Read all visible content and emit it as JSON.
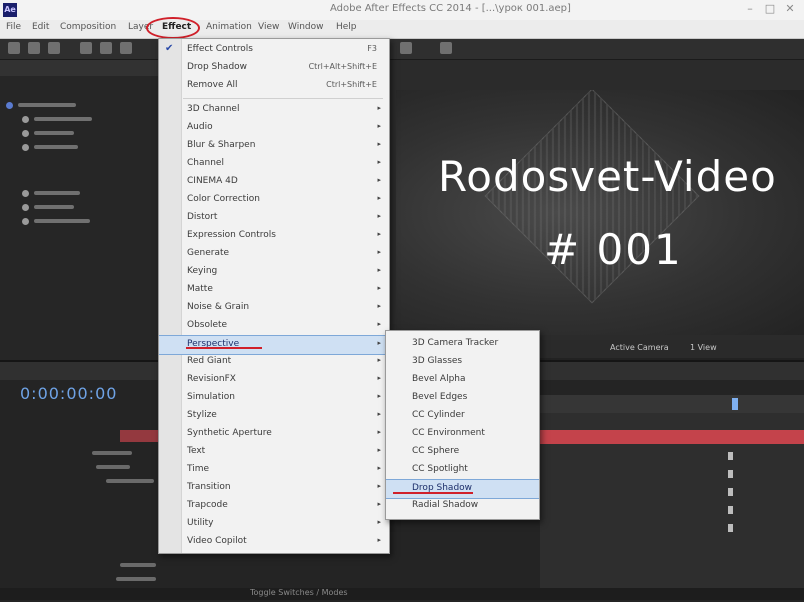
{
  "window": {
    "title": "Adobe After Effects CC 2014 - [...\\урок 001.aep]",
    "logo_text": "Ae",
    "controls": [
      "–",
      "□",
      "✕"
    ]
  },
  "menubar": [
    "File",
    "Edit",
    "Composition",
    "Layer",
    "Effect",
    "Animation",
    "View",
    "Window",
    "Help"
  ],
  "effect_menu": {
    "items": [
      {
        "label": "Effect Controls",
        "shortcut": "F3",
        "checked": true
      },
      {
        "label": "Drop Shadow",
        "shortcut": "Ctrl+Alt+Shift+E"
      },
      {
        "label": "Remove All",
        "shortcut": "Ctrl+Shift+E"
      },
      {
        "label": "3D Channel",
        "submenu": true
      },
      {
        "label": "Audio",
        "submenu": true
      },
      {
        "label": "Blur & Sharpen",
        "submenu": true
      },
      {
        "label": "Channel",
        "submenu": true
      },
      {
        "label": "CINEMA 4D",
        "submenu": true
      },
      {
        "label": "Color Correction",
        "submenu": true
      },
      {
        "label": "Distort",
        "submenu": true
      },
      {
        "label": "Expression Controls",
        "submenu": true
      },
      {
        "label": "Generate",
        "submenu": true
      },
      {
        "label": "Keying",
        "submenu": true
      },
      {
        "label": "Matte",
        "submenu": true
      },
      {
        "label": "Noise & Grain",
        "submenu": true
      },
      {
        "label": "Obsolete",
        "submenu": true
      },
      {
        "label": "Perspective",
        "submenu": true,
        "highlighted": true
      },
      {
        "label": "Red Giant",
        "submenu": true
      },
      {
        "label": "RevisionFX",
        "submenu": true
      },
      {
        "label": "Simulation",
        "submenu": true
      },
      {
        "label": "Stylize",
        "submenu": true
      },
      {
        "label": "Synthetic Aperture",
        "submenu": true
      },
      {
        "label": "Text",
        "submenu": true
      },
      {
        "label": "Time",
        "submenu": true
      },
      {
        "label": "Transition",
        "submenu": true
      },
      {
        "label": "Trapcode",
        "submenu": true
      },
      {
        "label": "Utility",
        "submenu": true
      },
      {
        "label": "Video Copilot",
        "submenu": true
      }
    ]
  },
  "perspective_submenu": {
    "items": [
      {
        "label": "3D Camera Tracker"
      },
      {
        "label": "3D Glasses"
      },
      {
        "label": "Bevel Alpha"
      },
      {
        "label": "Bevel Edges"
      },
      {
        "label": "CC Cylinder"
      },
      {
        "label": "CC Environment"
      },
      {
        "label": "CC Sphere"
      },
      {
        "label": "CC Spotlight"
      },
      {
        "label": "Drop Shadow",
        "highlighted": true
      },
      {
        "label": "Radial Shadow"
      }
    ]
  },
  "composition": {
    "title": "Rodosvet-Video",
    "number": "# 001"
  },
  "viewer_controls": {
    "camera": "Active Camera",
    "views": "1 View"
  },
  "timeline": {
    "timecode": "0:00:00:00"
  },
  "status": {
    "text": "Toggle Switches / Modes"
  },
  "colors": {
    "highlight": "#cfe0f3",
    "annotation_red": "#d0202a",
    "layer_bar": "#c4434b"
  }
}
